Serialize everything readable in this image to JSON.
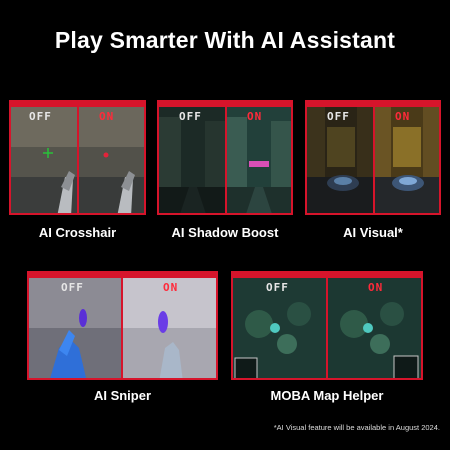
{
  "title": "Play Smarter With AI Assistant",
  "comparison_labels": {
    "off": "OFF",
    "on": "ON"
  },
  "features": [
    {
      "name": "AI Crosshair"
    },
    {
      "name": "AI Shadow Boost"
    },
    {
      "name": "AI Visual*"
    },
    {
      "name": "AI Sniper"
    },
    {
      "name": "MOBA Map Helper"
    }
  ],
  "footnote": "*AI Visual feature will be available in August 2024.",
  "colors": {
    "accent": "#d6142b",
    "on_label": "#ff2a3a",
    "background": "#000000"
  }
}
